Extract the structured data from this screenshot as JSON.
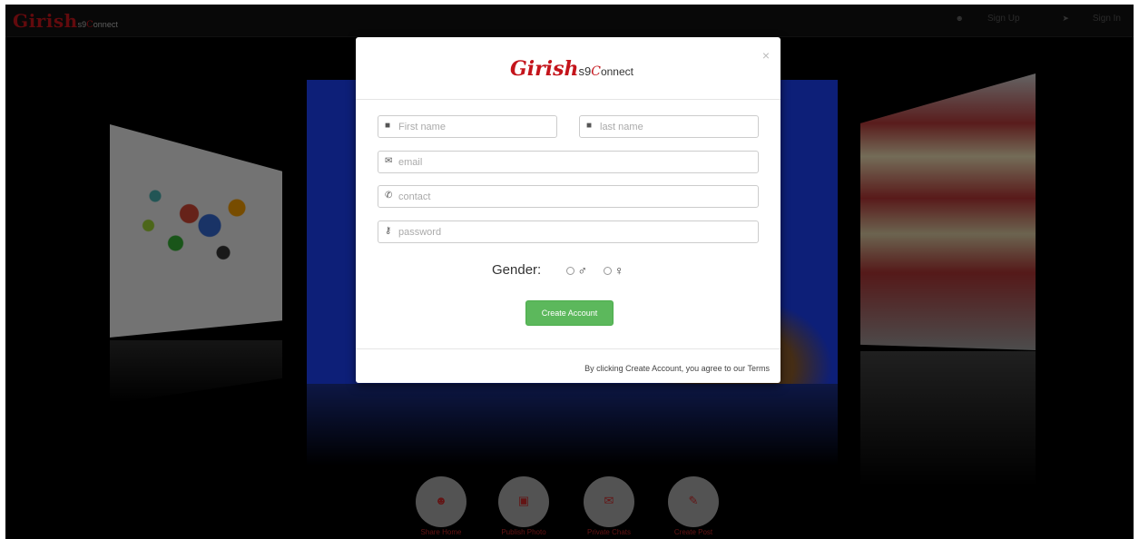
{
  "navbar": {
    "brand_main": "Girish",
    "brand_sub": "s9",
    "brand_sub_c": "C",
    "brand_sub_rest": "onnect",
    "signup_label": "Sign Up",
    "signin_label": "Sign In",
    "user_icon": "user-icon",
    "signin_icon": "sign-in-icon"
  },
  "modal": {
    "close_glyph": "×",
    "logo": {
      "main": "Girish",
      "s9": "s9",
      "c": "C",
      "rest": "onnect"
    },
    "fields": {
      "first_name": {
        "placeholder": "First name",
        "icon": "user-icon"
      },
      "last_name": {
        "placeholder": "last name",
        "icon": "user-icon"
      },
      "email": {
        "placeholder": "email",
        "icon": "envelope-icon"
      },
      "contact": {
        "placeholder": "contact",
        "icon": "phone-icon"
      },
      "password": {
        "placeholder": "password",
        "icon": "key-icon"
      }
    },
    "gender": {
      "label": "Gender:",
      "options": [
        "male-icon",
        "female-icon"
      ]
    },
    "create_button": "Create Account",
    "terms_text": "By clicking Create Account, you agree to our Terms"
  },
  "bottom_nav": [
    {
      "icon": "add-user-icon",
      "label": "Share Home"
    },
    {
      "icon": "picture-icon",
      "label": "Publish Photo"
    },
    {
      "icon": "chat-icon",
      "label": "Private Chats"
    },
    {
      "icon": "edit-icon",
      "label": "Create Post"
    }
  ],
  "colors": {
    "brand_red": "#c4141b",
    "button_green": "#5cb85c",
    "carousel_blue": "#1b3ef0",
    "circle_grey": "#a7a7a7"
  }
}
